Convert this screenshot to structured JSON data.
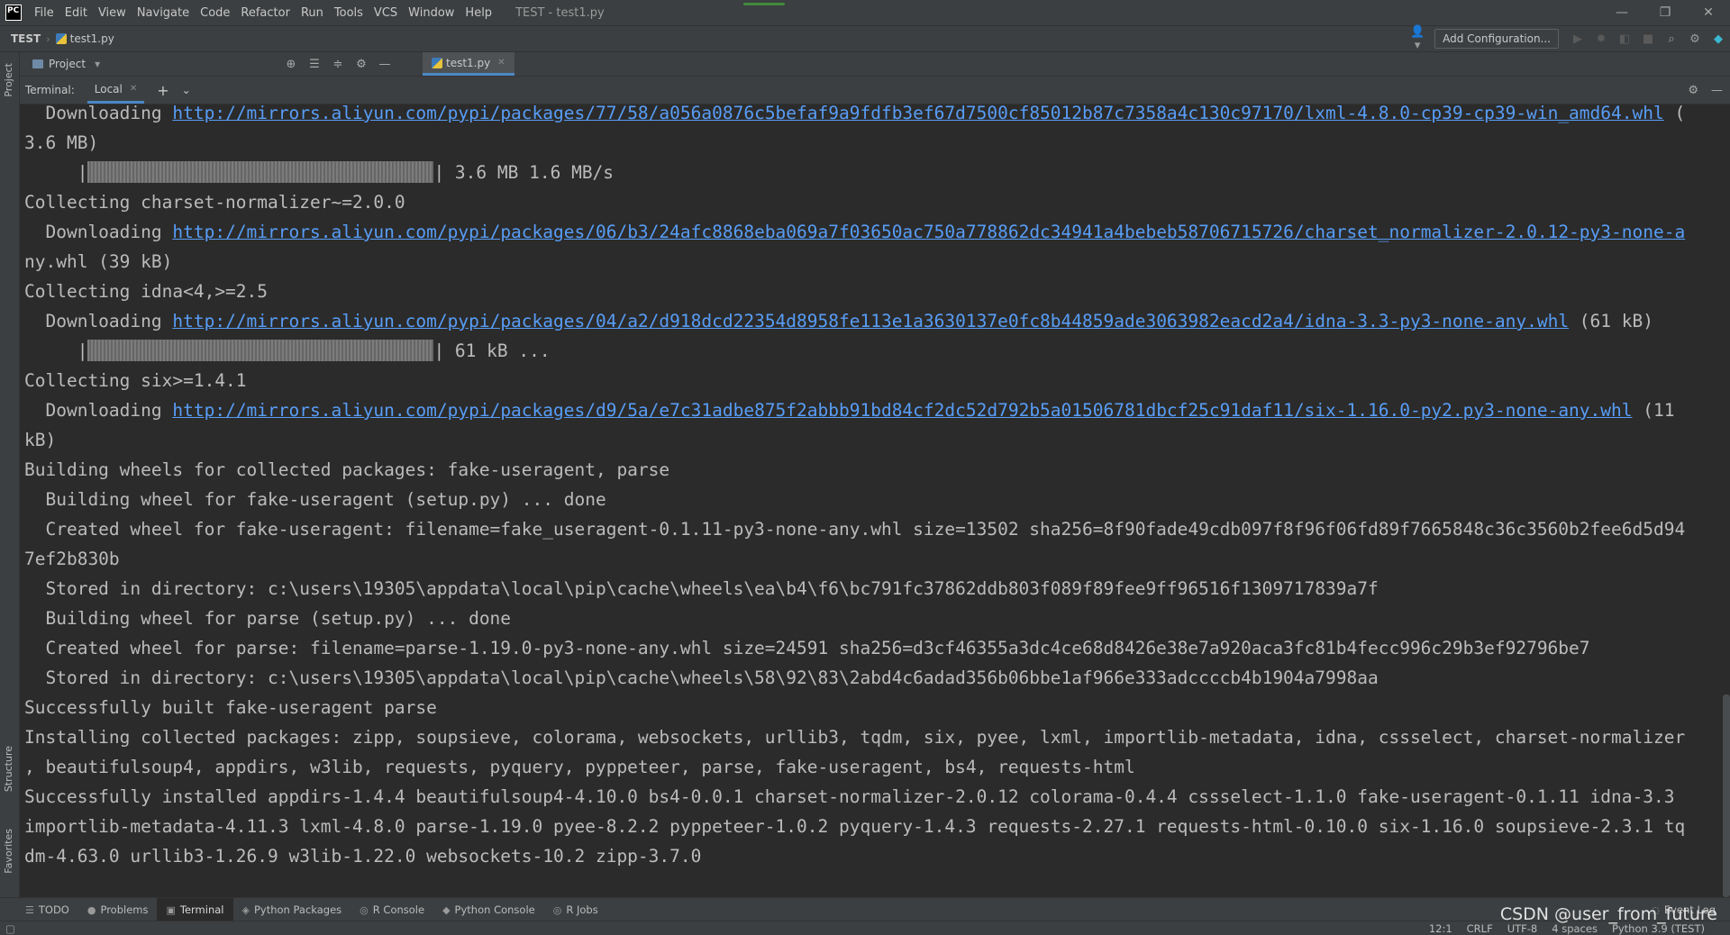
{
  "menubar": {
    "logo": "PC",
    "items": [
      "File",
      "Edit",
      "View",
      "Navigate",
      "Code",
      "Refactor",
      "Run",
      "Tools",
      "VCS",
      "Window",
      "Help"
    ],
    "window_title": "TEST - test1.py",
    "minimize": "—",
    "restore": "❐",
    "close": "✕"
  },
  "navbar": {
    "project": "TEST",
    "separator": "›",
    "file": "test1.py",
    "user_icon": "👤▾",
    "add_config": "Add Configuration...",
    "run_icon": "▶",
    "debug_icon": "✹",
    "coverage_icon": "◧",
    "stop_icon": "■",
    "search_icon": "⌕",
    "settings_icon": "⚙",
    "logo_icon": "◆"
  },
  "left_strip": {
    "project": "Project",
    "structure": "Structure",
    "favorites": "Favorites"
  },
  "project_toolbar": {
    "title": "Project",
    "dropdown": "▾",
    "locate_icon": "⊕",
    "expand_icon": "☰",
    "collapse_icon": "≑",
    "gear_icon": "⚙",
    "hide_icon": "—",
    "tab_file": "test1.py",
    "tab_close": "✕"
  },
  "terminal_header": {
    "label": "Terminal:",
    "tab": "Local",
    "tab_close": "✕",
    "add": "+",
    "dropdown": "⌄",
    "gear_icon": "⚙",
    "hide_icon": "—"
  },
  "terminal": {
    "lines": [
      {
        "pre": "  Downloading ",
        "link": "http://mirrors.aliyun.com/pypi/packages/77/58/a056a0876c5befaf9a9fdfb3ef67d7500cf85012b87c7358a4c130c97170/lxml-4.8.0-cp39-cp39-win_amd64.whl",
        "post": " ("
      },
      {
        "text": "3.6 MB)"
      },
      {
        "bar": true,
        "pre": "     |",
        "post": "| 3.6 MB 1.6 MB/s"
      },
      {
        "text": "Collecting charset-normalizer~=2.0.0"
      },
      {
        "pre": "  Downloading ",
        "link": "http://mirrors.aliyun.com/pypi/packages/06/b3/24afc8868eba069a7f03650ac750a778862dc34941a4bebeb58706715726/charset_normalizer-2.0.12-py3-none-a",
        "post": ""
      },
      {
        "text": "ny.whl (39 kB)"
      },
      {
        "text": "Collecting idna<4,>=2.5"
      },
      {
        "pre": "  Downloading ",
        "link": "http://mirrors.aliyun.com/pypi/packages/04/a2/d918dcd22354d8958fe113e1a3630137e0fc8b44859ade3063982eacd2a4/idna-3.3-py3-none-any.whl",
        "post": " (61 kB)"
      },
      {
        "bar": true,
        "pre": "     |",
        "post": "| 61 kB ..."
      },
      {
        "text": "Collecting six>=1.4.1"
      },
      {
        "pre": "  Downloading ",
        "link": "http://mirrors.aliyun.com/pypi/packages/d9/5a/e7c31adbe875f2abbb91bd84cf2dc52d792b5a01506781dbcf25c91daf11/six-1.16.0-py2.py3-none-any.whl",
        "post": " (11"
      },
      {
        "text": "kB)"
      },
      {
        "text": "Building wheels for collected packages: fake-useragent, parse"
      },
      {
        "text": "  Building wheel for fake-useragent (setup.py) ... done"
      },
      {
        "text": "  Created wheel for fake-useragent: filename=fake_useragent-0.1.11-py3-none-any.whl size=13502 sha256=8f90fade49cdb097f8f96f06fd89f7665848c36c3560b2fee6d5d94"
      },
      {
        "text": "7ef2b830b"
      },
      {
        "text": "  Stored in directory: c:\\users\\19305\\appdata\\local\\pip\\cache\\wheels\\ea\\b4\\f6\\bc791fc37862ddb803f089f89fee9ff96516f1309717839a7f"
      },
      {
        "text": "  Building wheel for parse (setup.py) ... done"
      },
      {
        "text": "  Created wheel for parse: filename=parse-1.19.0-py3-none-any.whl size=24591 sha256=d3cf46355a3dc4ce68d8426e38e7a920aca3fc81b4fecc996c29b3ef92796be7"
      },
      {
        "text": "  Stored in directory: c:\\users\\19305\\appdata\\local\\pip\\cache\\wheels\\58\\92\\83\\2abd4c6adad356b06bbe1af966e333adccccb4b1904a7998aa"
      },
      {
        "text": "Successfully built fake-useragent parse"
      },
      {
        "text": "Installing collected packages: zipp, soupsieve, colorama, websockets, urllib3, tqdm, six, pyee, lxml, importlib-metadata, idna, cssselect, charset-normalizer"
      },
      {
        "text": ", beautifulsoup4, appdirs, w3lib, requests, pyquery, pyppeteer, parse, fake-useragent, bs4, requests-html"
      },
      {
        "text": "Successfully installed appdirs-1.4.4 beautifulsoup4-4.10.0 bs4-0.0.1 charset-normalizer-2.0.12 colorama-0.4.4 cssselect-1.1.0 fake-useragent-0.1.11 idna-3.3"
      },
      {
        "text": "importlib-metadata-4.11.3 lxml-4.8.0 parse-1.19.0 pyee-8.2.2 pyppeteer-1.0.2 pyquery-1.4.3 requests-2.27.1 requests-html-0.10.0 six-1.16.0 soupsieve-2.3.1 tq"
      },
      {
        "text": "dm-4.63.0 urllib3-1.26.9 w3lib-1.22.0 websockets-10.2 zipp-3.7.0"
      }
    ]
  },
  "bottom_tabs": [
    {
      "icon": "☰",
      "label": "TODO",
      "active": false
    },
    {
      "icon": "●",
      "label": "Problems",
      "active": false
    },
    {
      "icon": "▣",
      "label": "Terminal",
      "active": true
    },
    {
      "icon": "◈",
      "label": "Python Packages",
      "active": false
    },
    {
      "icon": "◎",
      "label": "R Console",
      "active": false
    },
    {
      "icon": "◆",
      "label": "Python Console",
      "active": false
    },
    {
      "icon": "◎",
      "label": "R Jobs",
      "active": false
    }
  ],
  "event_log": {
    "icon": "◌",
    "label": "Event Log"
  },
  "statusbar": {
    "position": "12:1",
    "line_sep": "CRLF",
    "encoding": "UTF-8",
    "indent": "4 spaces",
    "interpreter": "Python 3.9 (TEST)"
  },
  "watermark": "CSDN @user_from_future",
  "colors": {
    "background": "#2b2b2b",
    "panel": "#3c3f41",
    "link": "#589df6",
    "accent": "#4a88c7",
    "text": "#bbbbbb"
  }
}
